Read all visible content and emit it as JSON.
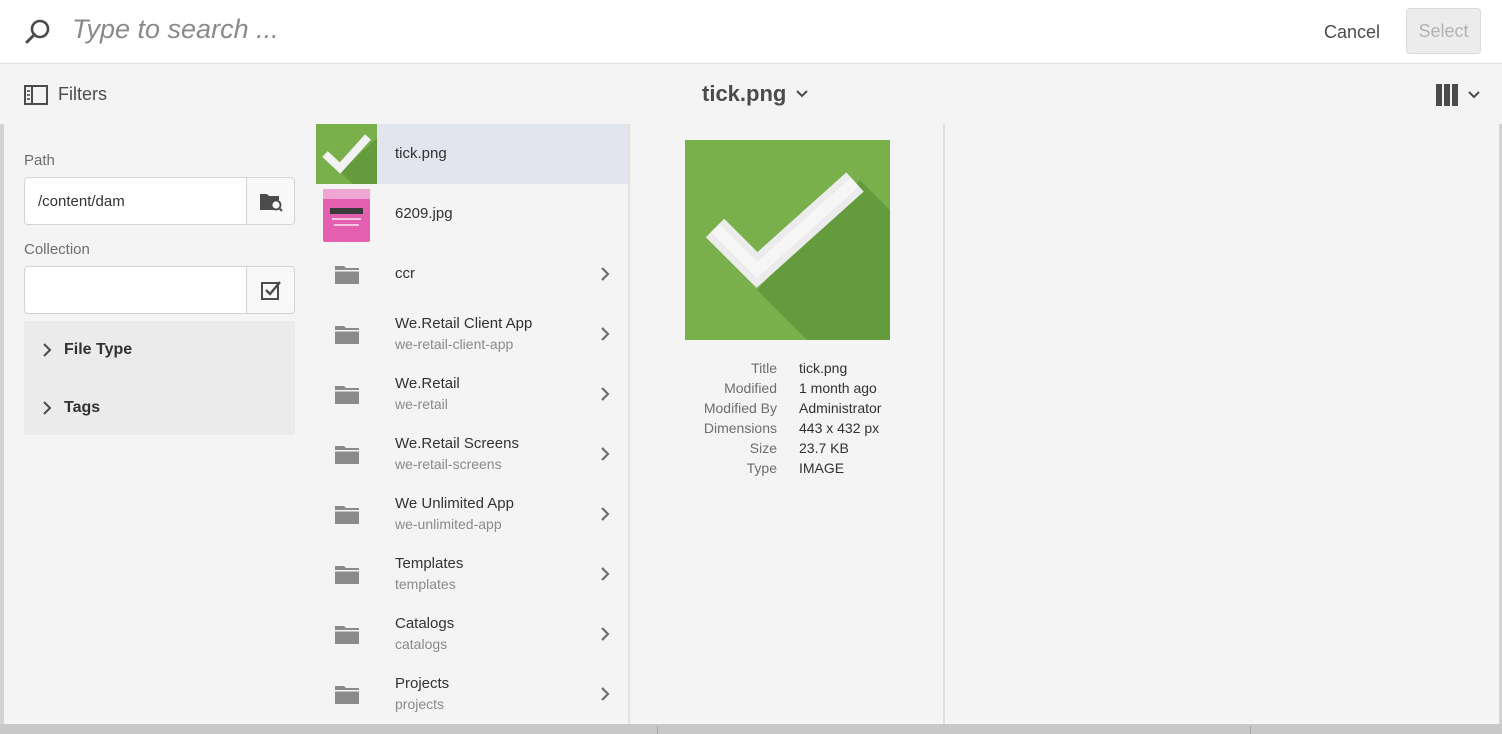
{
  "search": {
    "placeholder": "Type to search ..."
  },
  "actions": {
    "cancel": "Cancel",
    "select": "Select"
  },
  "toolbar": {
    "filters_label": "Filters",
    "title": "tick.png"
  },
  "filters": {
    "path_label": "Path",
    "path_value": "/content/dam",
    "collection_label": "Collection",
    "collection_value": "",
    "groups": [
      {
        "label": "File Type"
      },
      {
        "label": "Tags"
      }
    ]
  },
  "items": [
    {
      "name": "tick.png",
      "sub": "",
      "kind": "image-tick",
      "selected": true
    },
    {
      "name": "6209.jpg",
      "sub": "",
      "kind": "image-product",
      "selected": false
    },
    {
      "name": "ccr",
      "sub": "",
      "kind": "folder",
      "selected": false
    },
    {
      "name": "We.Retail Client App",
      "sub": "we-retail-client-app",
      "kind": "folder",
      "selected": false
    },
    {
      "name": "We.Retail",
      "sub": "we-retail",
      "kind": "folder",
      "selected": false
    },
    {
      "name": "We.Retail Screens",
      "sub": "we-retail-screens",
      "kind": "folder",
      "selected": false
    },
    {
      "name": "We Unlimited App",
      "sub": "we-unlimited-app",
      "kind": "folder",
      "selected": false
    },
    {
      "name": "Templates",
      "sub": "templates",
      "kind": "folder",
      "selected": false
    },
    {
      "name": "Catalogs",
      "sub": "catalogs",
      "kind": "folder",
      "selected": false
    },
    {
      "name": "Projects",
      "sub": "projects",
      "kind": "folder",
      "selected": false
    }
  ],
  "details": {
    "rows": [
      {
        "key": "Title",
        "value": "tick.png"
      },
      {
        "key": "Modified",
        "value": "1 month ago"
      },
      {
        "key": "Modified By",
        "value": "Administrator"
      },
      {
        "key": "Dimensions",
        "value": "443 x 432 px"
      },
      {
        "key": "Size",
        "value": "23.7 KB"
      },
      {
        "key": "Type",
        "value": "IMAGE"
      }
    ]
  },
  "colors": {
    "accent_green": "#7ab04c",
    "selected_row": "#e2e5ee",
    "folder_gray": "#8a8a8a"
  },
  "icons": {
    "search": "search-icon",
    "filters": "filter-panel-icon",
    "title_dropdown": "chevron-down-icon",
    "view": "column-view-icon",
    "path_browse": "folder-browse-icon",
    "collection": "checkbox-icon",
    "expand": "chevron-right-icon",
    "folder": "folder-icon"
  }
}
